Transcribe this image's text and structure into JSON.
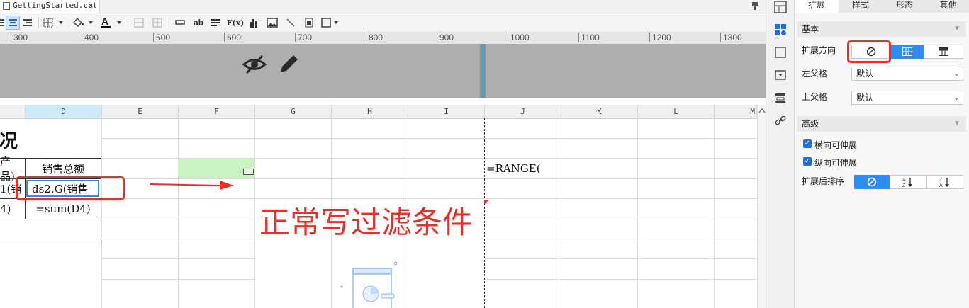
{
  "tab": {
    "filename": "GettingStarted.cpt",
    "close": "×"
  },
  "toolbar": {
    "text_ab": "ab",
    "fx": "F(x)"
  },
  "ruler": {
    "labels": [
      "300",
      "400",
      "500",
      "600",
      "700",
      "800",
      "900",
      "1000",
      "1100",
      "1200",
      "1300"
    ]
  },
  "grid": {
    "columns": [
      "D",
      "E",
      "F",
      "G",
      "H",
      "I",
      "J",
      "K",
      "L",
      "M"
    ],
    "cells": {
      "title_partial": "况",
      "header_left_partial": "产品)",
      "header_sales_total": "销售总额",
      "row1_left_partial": "1(销",
      "row1_formula": "ds2.G(销售",
      "row2_left_partial": "4)",
      "row2_formula": "=sum(D4)",
      "range_formula": "=RANGE("
    }
  },
  "annotation": {
    "text": "正常写过滤条件",
    "color": "#e8302a"
  },
  "panel": {
    "tabs": [
      "扩展",
      "样式",
      "形态",
      "其他"
    ],
    "basic_section": "基本",
    "expand_direction_label": "扩展方向",
    "left_parent_label": "左父格",
    "left_parent_value": "默认",
    "top_parent_label": "上父格",
    "top_parent_value": "默认",
    "advanced_section": "高级",
    "horizontal_extend": "横向可伸展",
    "vertical_extend": "纵向可伸展",
    "sort_label": "扩展后排序"
  },
  "colors": {
    "accent": "#2f8cf0",
    "highlight_red": "#e8302a",
    "green_cell": "#c9f3c0"
  }
}
